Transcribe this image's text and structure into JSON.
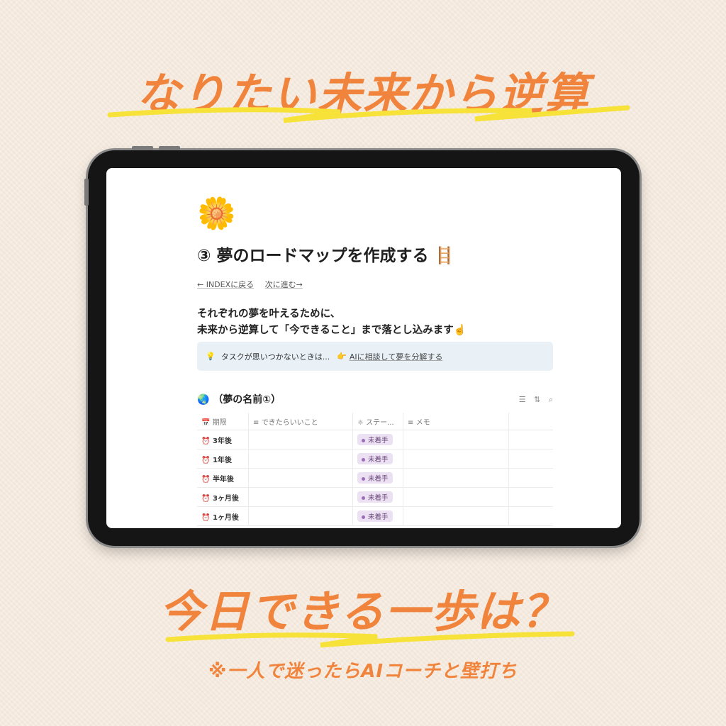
{
  "headline_top": "なりたい未来から逆算",
  "headline_bottom": "今日できる一歩は？",
  "headline_sub": "※一人で迷ったらAIコーチと壁打ち",
  "colors": {
    "accent": "#f0843d",
    "highlight": "#f7e23a",
    "status_bg": "#ece0f3"
  },
  "page": {
    "icon": "🌼",
    "title": "③ 夢のロードマップを作成する 🪜",
    "nav_back": "← INDEXに戻る",
    "nav_next": "次に進む→",
    "intro_line1": "それぞれの夢を叶えるために、",
    "intro_line2": "未来から逆算して「今できること」まで落とし込みます☝️",
    "callout_icon": "💡",
    "callout_text": "タスクが思いつかないときは...",
    "callout_link_icon": "👉",
    "callout_link": "AIに相談して夢を分解する"
  },
  "database": {
    "icon": "🌏",
    "title": "（夢の名前①）",
    "columns": [
      {
        "icon": "📅",
        "label": "期限"
      },
      {
        "icon": "≡",
        "label": "できたらいいこと"
      },
      {
        "icon": "☼",
        "label": "ステー..."
      },
      {
        "icon": "≡",
        "label": "メモ"
      }
    ],
    "rows": [
      {
        "icon": "⏰",
        "period": "3年後",
        "status": "未着手"
      },
      {
        "icon": "⏰",
        "period": "1年後",
        "status": "未着手"
      },
      {
        "icon": "⏰",
        "period": "半年後",
        "status": "未着手"
      },
      {
        "icon": "⏰",
        "period": "3ヶ月後",
        "status": "未着手"
      },
      {
        "icon": "⏰",
        "period": "1ヶ月後",
        "status": "未着手"
      }
    ]
  }
}
